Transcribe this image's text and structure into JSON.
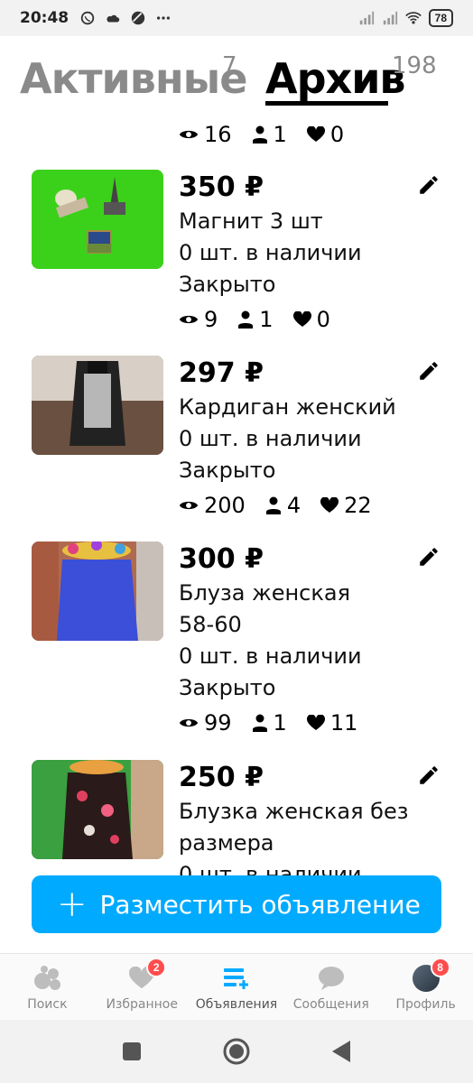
{
  "status_bar": {
    "time": "20:48",
    "battery": "78",
    "icons_left": [
      "viber-icon",
      "cloud-icon",
      "moon-icon",
      "more-icon"
    ],
    "icons_right": [
      "signal-icon",
      "signal-icon",
      "wifi-icon",
      "battery-icon"
    ]
  },
  "tabs": {
    "active_label": "Активные",
    "active_count": "7",
    "archive_label": "Архив",
    "archive_count": "198",
    "selected": "archive"
  },
  "partial_item": {
    "views": "16",
    "contacts": "1",
    "favorites": "0"
  },
  "items": [
    {
      "price": "350 ₽",
      "title_lines": [
        "Магнит 3 шт"
      ],
      "stock": "0 шт. в наличии",
      "status": "Закрыто",
      "views": "9",
      "contacts": "1",
      "favorites": "0",
      "thumb_color": "#3bd11a"
    },
    {
      "price": "297 ₽",
      "title_lines": [
        "Кардиган женский"
      ],
      "stock": "0 шт. в наличии",
      "status": "Закрыто",
      "views": "200",
      "contacts": "4",
      "favorites": "22",
      "thumb_color": "#5a4a3c"
    },
    {
      "price": "300 ₽",
      "title_lines": [
        "Блуза женская",
        "58-60"
      ],
      "stock": "0 шт. в наличии",
      "status": "Закрыто",
      "views": "99",
      "contacts": "1",
      "favorites": "11",
      "thumb_color": "#3c4fd8"
    },
    {
      "price": "250 ₽",
      "title_lines": [
        "Блузка женская без",
        "размера"
      ],
      "stock": "0 шт. в наличии",
      "status": "",
      "views": "",
      "contacts": "",
      "favorites": "",
      "thumb_color": "#2a2020"
    }
  ],
  "post_button": {
    "label": "Разместить объявление"
  },
  "bottom_nav": {
    "items": [
      {
        "label": "Поиск",
        "icon": "search-bubbles-icon",
        "badge": ""
      },
      {
        "label": "Избранное",
        "icon": "heart-icon",
        "badge": "2"
      },
      {
        "label": "Объявления",
        "icon": "listings-icon",
        "badge": ""
      },
      {
        "label": "Сообщения",
        "icon": "message-icon",
        "badge": ""
      },
      {
        "label": "Профиль",
        "icon": "avatar-icon",
        "badge": "8"
      }
    ],
    "active_index": 2
  },
  "colors": {
    "accent": "#00aaff",
    "badge": "#ff4d4d",
    "muted": "#8a8a8a"
  }
}
